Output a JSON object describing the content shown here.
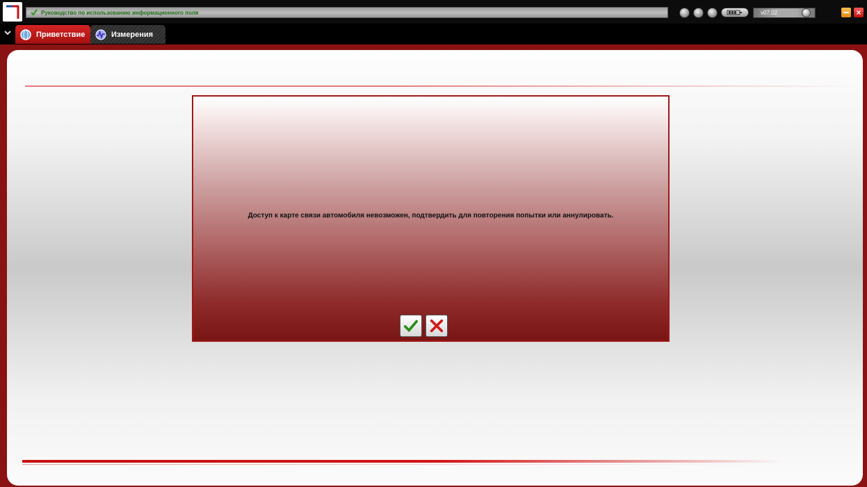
{
  "titlebar": {
    "status_text": "Руководство по использованию информационного поля",
    "version": "v07.02"
  },
  "tabs": [
    {
      "label": "Приветствие",
      "active": true
    },
    {
      "label": "Измерения",
      "active": false
    }
  ],
  "dialog": {
    "message": "Доступ к карте связи автомобиля невозможен, подтвердить для повторения попытки или аннулировать."
  },
  "icons": {
    "status": "check-icon",
    "confirm": "check-icon",
    "cancel": "close-icon"
  },
  "colors": {
    "accent": "#c41414",
    "status_text": "#1e6e14"
  }
}
